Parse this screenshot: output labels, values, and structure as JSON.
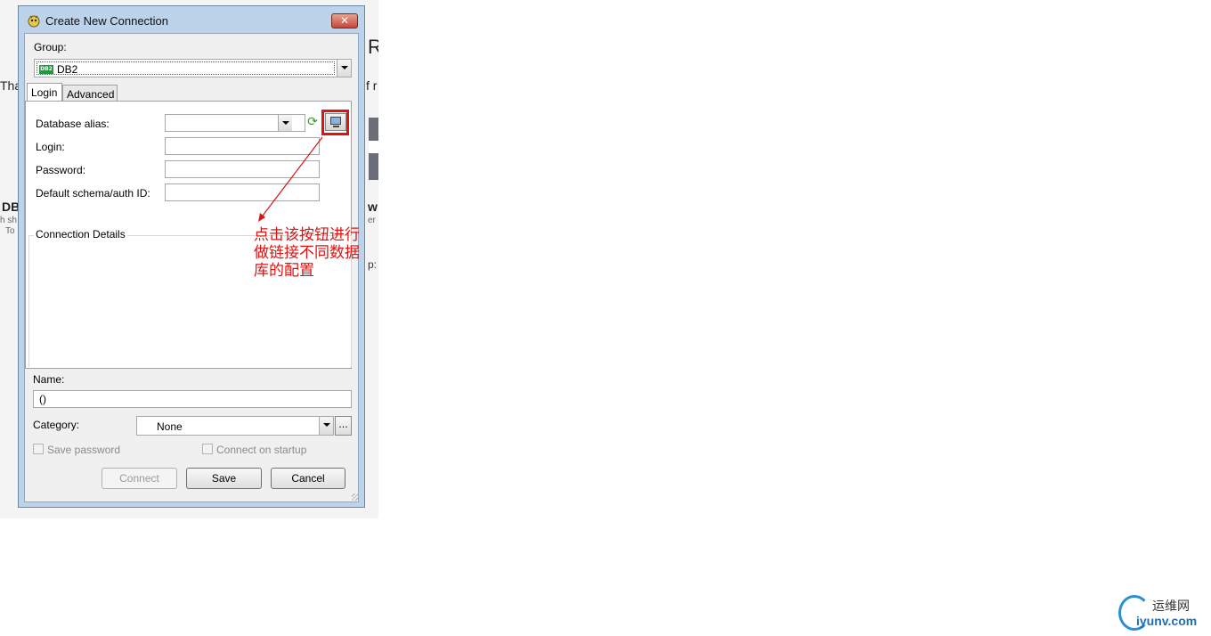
{
  "background_fragments": {
    "r": "R",
    "tha": "Tha",
    "f": "f r",
    "db": "DB",
    "w": "w",
    "hs": "h sh",
    "er": "er",
    "to": "To",
    "p": "p:"
  },
  "dialog": {
    "title": "Create New Connection",
    "close_glyph": "✕",
    "group_label": "Group:",
    "group_badge": "DB2",
    "group_value": "DB2",
    "tabs": [
      {
        "label": "Login",
        "active": true
      },
      {
        "label": "Advanced",
        "active": false
      }
    ],
    "login": {
      "database_alias_label": "Database alias:",
      "database_alias_value": "",
      "login_label": "Login:",
      "login_value": "",
      "password_label": "Password:",
      "password_value": "",
      "schema_label": "Default schema/auth ID:",
      "schema_value": "",
      "details_title": "Connection Details"
    },
    "name_label": "Name:",
    "name_value": "()",
    "category_label": "Category:",
    "category_value": "None",
    "ellipsis_label": "...",
    "save_password_label": "Save password",
    "connect_on_startup_label": "Connect on startup",
    "buttons": {
      "connect": "Connect",
      "save": "Save",
      "cancel": "Cancel"
    }
  },
  "annotation": {
    "text": "点击该按钮进行\n做链接不同数据\n库的配置",
    "color": "#e01212"
  },
  "watermark": {
    "cn": "运维网",
    "en": "iyunv.com"
  }
}
